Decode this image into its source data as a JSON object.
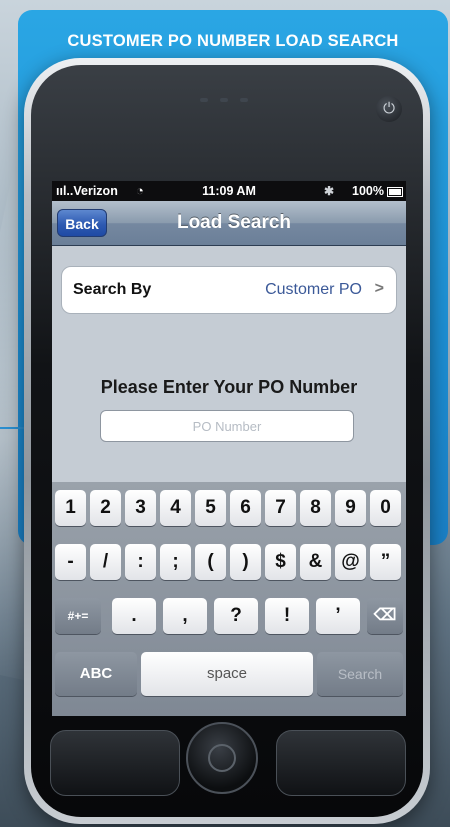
{
  "banner": {
    "title": "CUSTOMER PO NUMBER LOAD SEARCH",
    "color": "#1d8fd4"
  },
  "status_bar": {
    "carrier": "Verizon",
    "time": "11:09 AM",
    "battery": "100%",
    "icons": [
      "signal-bars-icon",
      "wifi-icon",
      "bluetooth-icon",
      "battery-icon"
    ]
  },
  "nav": {
    "back_label": "Back",
    "title": "Load Search"
  },
  "search_by": {
    "label": "Search By",
    "value": "Customer PO"
  },
  "prompt": "Please Enter Your PO Number",
  "po_input": {
    "placeholder": "PO Number",
    "value": ""
  },
  "keyboard": {
    "row1": [
      "1",
      "2",
      "3",
      "4",
      "5",
      "6",
      "7",
      "8",
      "9",
      "0"
    ],
    "row2": [
      "-",
      "/",
      ":",
      ";",
      "(",
      ")",
      "$",
      "&",
      "@",
      "”"
    ],
    "row3": {
      "symbols_toggle": "#+=",
      "keys": [
        ".",
        ",",
        "?",
        "!",
        "’"
      ],
      "delete_icon": "backspace-icon"
    },
    "row4": {
      "abc": "ABC",
      "space": "space",
      "search": "Search"
    }
  }
}
